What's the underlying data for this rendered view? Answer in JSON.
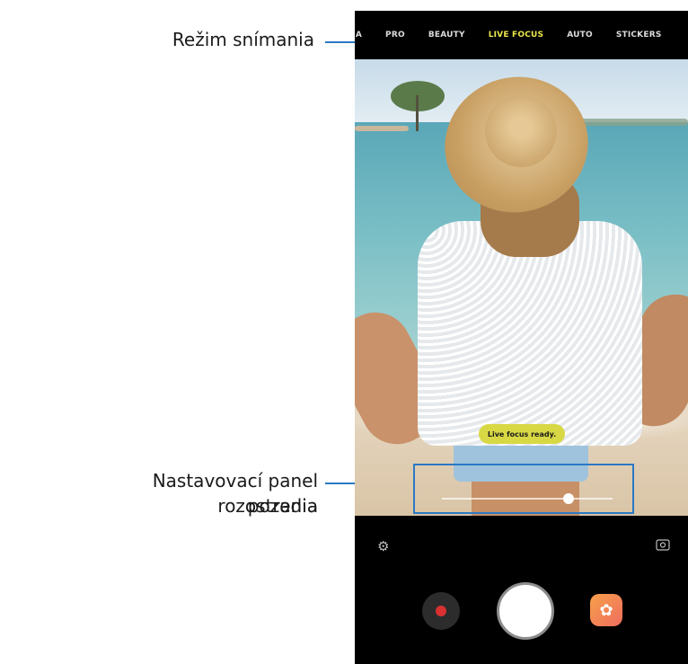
{
  "callouts": {
    "mode_label": "Režim snímania",
    "blur_label_line1": "Nastavovací panel rozostrenia",
    "blur_label_line2": "pozadia"
  },
  "camera": {
    "modes": [
      "...A",
      "PRO",
      "BEAUTY",
      "LIVE FOCUS",
      "AUTO",
      "STICKERS"
    ],
    "active_mode_index": 3,
    "toast": "Live focus ready.",
    "blur_level": 0.74,
    "icons": {
      "settings": "gear-icon",
      "switch_camera": "switch-camera-icon",
      "record": "record-icon",
      "shutter": "shutter-icon",
      "bixby_vision": "bixby-flower-icon"
    },
    "colors": {
      "active_mode": "#e9e64c",
      "callout_line": "#2b78c4",
      "toast_bg": "#d8d845",
      "record_dot": "#d93131"
    }
  }
}
